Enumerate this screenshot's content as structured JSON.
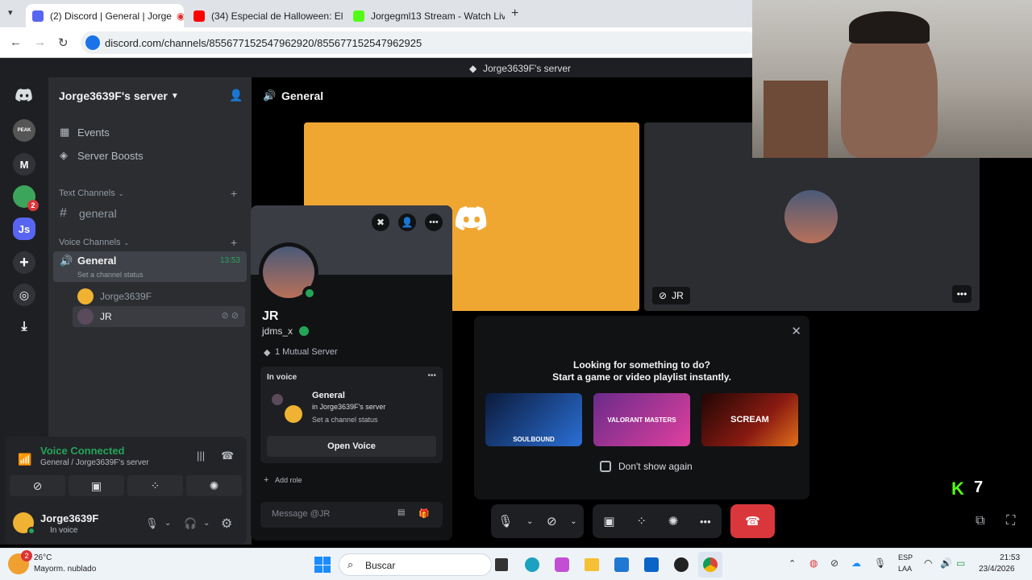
{
  "browser": {
    "tabs": [
      {
        "title": "(2) Discord | General | Jorge",
        "active": true
      },
      {
        "title": "(34) Especial de Halloween: El D",
        "active": false
      },
      {
        "title": "Jorgegml13 Stream - Watch Liv",
        "active": false
      }
    ],
    "url": "discord.com/channels/855677152547962920/855677152547962925"
  },
  "window_title": "Jorge3639F's server",
  "servers": [
    {
      "icon": "discord-logo-icon"
    },
    {
      "label": "PEAK"
    },
    {
      "label": "M"
    },
    {
      "badge": "2"
    },
    {
      "label": "Js"
    }
  ],
  "sidebar": {
    "server_name": "Jorge3639F's server",
    "items": [
      {
        "label": "Events",
        "icon": "calendar-icon"
      },
      {
        "label": "Server Boosts",
        "icon": "boost-icon"
      }
    ],
    "text_category": "Text Channels",
    "text_channels": [
      {
        "label": "general"
      }
    ],
    "voice_category": "Voice Channels",
    "voice_channel": {
      "label": "General",
      "timer": "13:53",
      "status": "Set a channel status"
    },
    "voice_users": [
      {
        "name": "Jorge3639F"
      },
      {
        "name": "JR"
      }
    ]
  },
  "voice_panel": {
    "title": "Voice Connected",
    "subtitle": "General / Jorge3639F's server"
  },
  "user_panel": {
    "name": "Jorge3639F",
    "status": "In voice"
  },
  "header": {
    "channel": "General"
  },
  "tiles": [
    {
      "name": "JR"
    }
  ],
  "profile": {
    "display_name": "JR",
    "username": "jdms_x",
    "mutual": "1 Mutual Server",
    "in_voice_label": "In voice",
    "voice_channel": "General",
    "voice_server": "in Jorge3639F's server",
    "voice_status": "Set a channel status",
    "open_voice": "Open Voice",
    "add_role": "Add role",
    "message_placeholder": "Message @JR"
  },
  "activity": {
    "title": "Looking for something to do?",
    "subtitle": "Start a game or video playlist instantly.",
    "cards": [
      {
        "label": "SOULBOUND",
        "color": "#2a6fd6"
      },
      {
        "label": "VALORANT MASTERS",
        "color": "#b23fa6"
      },
      {
        "label": "SCREAM",
        "color": "#8a1b12"
      }
    ],
    "dont_show": "Don't show again"
  },
  "kick": {
    "count": "7"
  },
  "taskbar": {
    "weather_temp": "26°C",
    "weather_desc": "Mayorm. nublado",
    "weather_badge": "2",
    "search": "Buscar",
    "lang1": "ESP",
    "lang2": "LAA",
    "time": "21:53",
    "date": "23/4/2026"
  },
  "colors": {
    "accent": "#5865f2",
    "green": "#23a55a",
    "red": "#da373c",
    "tile_orange": "#f0a732"
  }
}
